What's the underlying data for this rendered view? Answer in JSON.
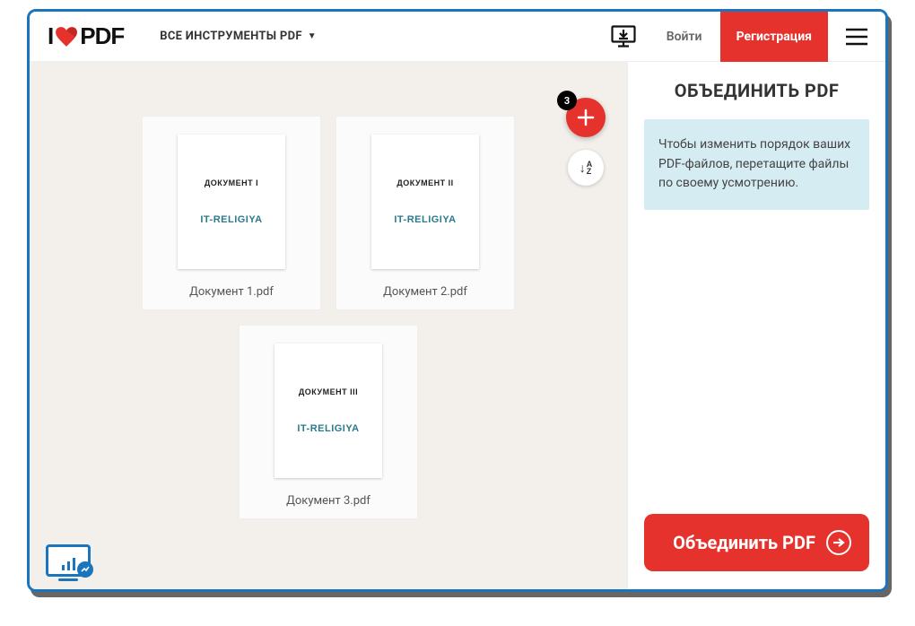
{
  "header": {
    "logo_prefix": "I",
    "logo_suffix": "PDF",
    "tools_label": "ВСЕ ИНСТРУМЕНТЫ PDF",
    "login_label": "Войти",
    "register_label": "Регистрация"
  },
  "canvas": {
    "file_count": "3",
    "files": [
      {
        "thumb_title": "ДОКУМЕНТ I",
        "thumb_brand": "IT-RELIGIYA",
        "name": "Документ 1.pdf"
      },
      {
        "thumb_title": "ДОКУМЕНТ II",
        "thumb_brand": "IT-RELIGIYA",
        "name": "Документ 2.pdf"
      },
      {
        "thumb_title": "ДОКУМЕНТ III",
        "thumb_brand": "IT-RELIGIYA",
        "name": "Документ 3.pdf"
      }
    ],
    "sort_label": "↓A Z"
  },
  "sidebar": {
    "title": "ОБЪЕДИНИТЬ PDF",
    "hint": "Чтобы изменить порядок ваших PDF-файлов, перетащите файлы по своему усмотрению.",
    "merge_label": "Объединить PDF"
  }
}
